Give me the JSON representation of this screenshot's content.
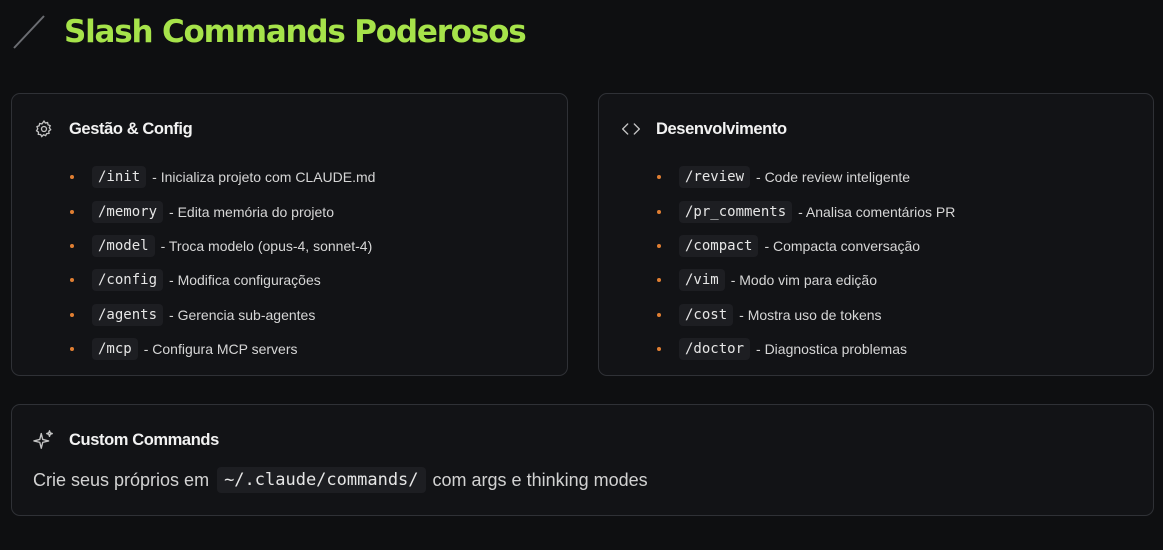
{
  "header": {
    "title": "Slash Commands Poderosos",
    "accent_color": "#a6e34a"
  },
  "cards": {
    "config": {
      "icon": "gear-icon",
      "title": "Gestão & Config",
      "items": [
        {
          "cmd": "/init",
          "desc": "- Inicializa projeto com CLAUDE.md"
        },
        {
          "cmd": "/memory",
          "desc": "- Edita memória do projeto"
        },
        {
          "cmd": "/model",
          "desc": "- Troca modelo (opus-4, sonnet-4)"
        },
        {
          "cmd": "/config",
          "desc": "- Modifica configurações"
        },
        {
          "cmd": "/agents",
          "desc": "- Gerencia sub-agentes"
        },
        {
          "cmd": "/mcp",
          "desc": "- Configura MCP servers"
        }
      ]
    },
    "dev": {
      "icon": "code-brackets-icon",
      "title": "Desenvolvimento",
      "items": [
        {
          "cmd": "/review",
          "desc": "- Code review inteligente"
        },
        {
          "cmd": "/pr_comments",
          "desc": "- Analisa comentários PR"
        },
        {
          "cmd": "/compact",
          "desc": "- Compacta conversação"
        },
        {
          "cmd": "/vim",
          "desc": "- Modo vim para edição"
        },
        {
          "cmd": "/cost",
          "desc": "- Mostra uso de tokens"
        },
        {
          "cmd": "/doctor",
          "desc": "- Diagnostica problemas"
        }
      ]
    },
    "custom": {
      "icon": "sparkles-icon",
      "title": "Custom Commands",
      "text_before": "Crie seus próprios em",
      "code": "~/.claude/commands/",
      "text_after": "com args e thinking modes"
    }
  },
  "colors": {
    "background": "#0e0f11",
    "bullet": "#e07f32",
    "card_border": "#2f3136"
  }
}
